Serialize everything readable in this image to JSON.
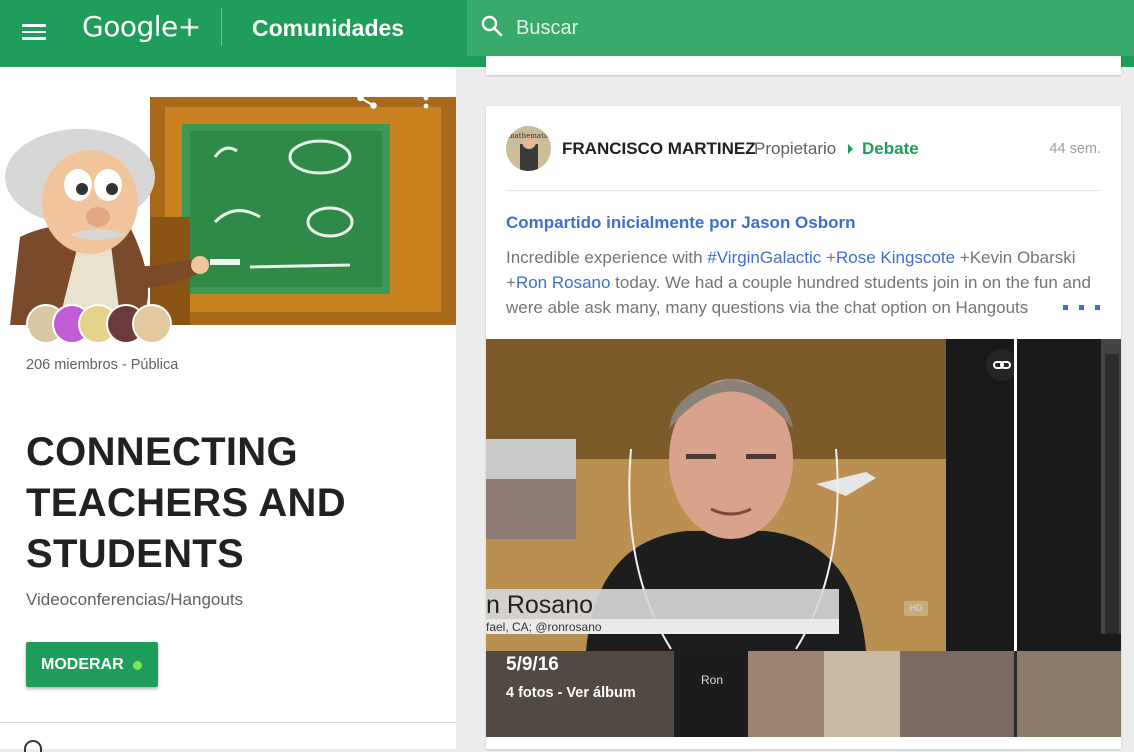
{
  "topbar": {
    "brand": "Google+",
    "section": "Comunidades",
    "search_placeholder": "Buscar"
  },
  "community": {
    "members": "206 miembros - Pública",
    "title": "CONNECTING TEACHERS AND STUDENTS",
    "category": "Videoconferencias/Hangouts",
    "moderate_label": "MODERAR"
  },
  "post": {
    "author": "FRANCISCO MARTINEZ",
    "role": "Propietario",
    "topic": "Debate",
    "time": "44 sem.",
    "shared_by": "Compartido inicialmente por Jason Osborn",
    "text": {
      "t1": "Incredible experience with ",
      "h1": "#VirginGalactic",
      "t2": " +",
      "m1": "Rose Kingscote",
      "t3": " +Kevin Obarski +",
      "m2": "Ron Rosano",
      "t4": " today.  We had a couple hundred students join in on the fun and were able ask many, many questions via the chat option on Hangouts"
    },
    "media": {
      "caption_name": "n Rosano",
      "caption_sub": "fael, CA; @ronrosano",
      "hd": "HD",
      "album_date": "5/9/16",
      "album_count": "4 fotos - Ver álbum",
      "ron_label": "Ron"
    }
  },
  "colors": {
    "primary": "#1e9e5a",
    "link": "#3f6ed3"
  }
}
